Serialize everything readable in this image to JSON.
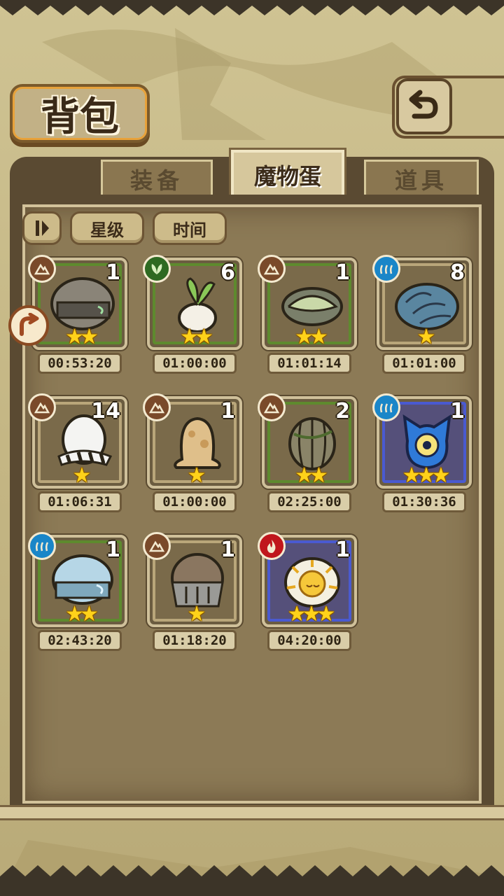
{
  "header": {
    "title": "背包",
    "back_icon": "back-arrow-icon"
  },
  "tabs": [
    {
      "label": "装备",
      "active": false
    },
    {
      "label": "魔物蛋",
      "active": true
    },
    {
      "label": "道具",
      "active": false
    }
  ],
  "sort": {
    "toggle_icon": "sort-toggle-icon",
    "star_label": "星级",
    "time_label": "时间"
  },
  "colors": {
    "grass_frame": "#5e8a2e",
    "rare_frame": "#4a5ad0",
    "star": "#ffd21a"
  },
  "eggs": [
    {
      "element": "earth",
      "count": "1",
      "stars": "★★",
      "time": "00:53:20"
    },
    {
      "element": "grass",
      "count": "6",
      "stars": "★★",
      "time": "01:00:00"
    },
    {
      "element": "earth",
      "count": "1",
      "stars": "★★",
      "time": "01:01:14"
    },
    {
      "element": "water",
      "count": "8",
      "stars": "★",
      "time": "01:01:00"
    },
    {
      "element": "earth",
      "count": "14",
      "stars": "★",
      "time": "01:06:31"
    },
    {
      "element": "earth",
      "count": "1",
      "stars": "★",
      "time": "01:00:00"
    },
    {
      "element": "earth",
      "count": "2",
      "stars": "★★",
      "time": "02:25:00"
    },
    {
      "element": "water",
      "count": "1",
      "stars": "★★★",
      "time": "01:30:36"
    },
    {
      "element": "water",
      "count": "1",
      "stars": "★★",
      "time": "02:43:20"
    },
    {
      "element": "earth",
      "count": "1",
      "stars": "★",
      "time": "01:18:20"
    },
    {
      "element": "fire",
      "count": "1",
      "stars": "★★★",
      "time": "04:20:00"
    }
  ]
}
